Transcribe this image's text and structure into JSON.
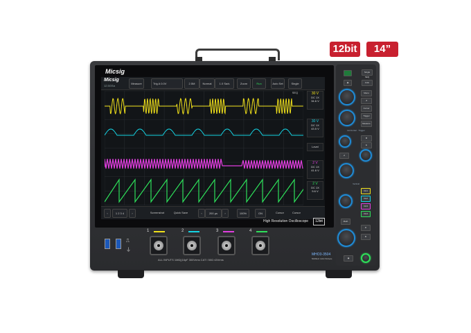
{
  "badges": {
    "bits": "12bit",
    "size": "14”"
  },
  "brand": "Micsig",
  "screen": {
    "top": {
      "status": "12.5GSa",
      "measure": "Measure",
      "trigger": "Trig A",
      "trigger_val": "0.0V",
      "memory": "2.5M",
      "normal": "Normal",
      "sample": "1.0 Sa/s",
      "zoom": "Zoom",
      "run": "Run",
      "auto": "Auto Set",
      "single": "Single SEQ"
    },
    "channels": [
      {
        "label": "30 V",
        "sub": "DC 1X",
        "val": "34.6 V",
        "color": "#f2e21a"
      },
      {
        "label": "30 V",
        "sub": "DC 1X",
        "val": "43.5 V",
        "color": "#14d6e6"
      },
      {
        "label": "2 V",
        "sub": "DC 1X",
        "val": "41.6 V",
        "color": "#e23ee0"
      },
      {
        "label": "2 V",
        "sub": "DC 1X",
        "val": "5.6 V",
        "color": "#2ee05a"
      }
    ],
    "side_level": "Level",
    "bottom": {
      "ch_sel": "1 2 3 4",
      "screenshot": "Screenshot",
      "quick_save": "Quick Save",
      "timebase": "200 µs",
      "zoom_pct": "100%",
      "on": "ON",
      "cursor": "Cursor",
      "wave": "Cursor"
    }
  },
  "model_label": "High Resolution Oscilloscope",
  "model_bits": "12bit",
  "panel": {
    "top_labels": [
      "Single SEQ",
      "Auto"
    ],
    "menu": [
      "Menu",
      "Cursor",
      "Trigger",
      "Measure"
    ],
    "horizontal": "Horizontal",
    "trigger": "Trigger",
    "vertical": "Vertical",
    "ch_buttons": [
      "CH1",
      "CH2",
      "CH3",
      "CH4"
    ],
    "math": "Math"
  },
  "inputs": {
    "channels": [
      "1",
      "2",
      "3",
      "4"
    ],
    "spec": "ALL INPUTS 1MΩ||16pF   300Vrms CAT I   50Ω ≤5Vrms"
  },
  "model_name": "MHO3-3504",
  "model_spec": "500MHz 12bit 5GSa/s",
  "colors": {
    "accent": "#1f8bd6",
    "badge": "#c8202f"
  }
}
